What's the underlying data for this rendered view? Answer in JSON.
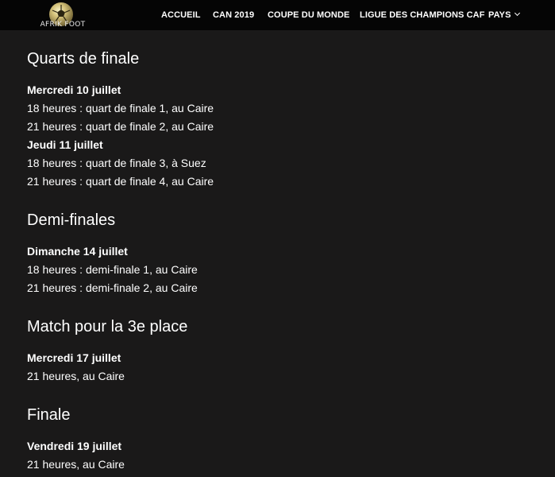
{
  "header": {
    "logo_text": "AFRIK FOOT",
    "nav": [
      {
        "label": "ACCUEIL"
      },
      {
        "label": "CAN 2019"
      },
      {
        "label": "COUPE DU MONDE"
      },
      {
        "label": "LIGUE DES CHAMPIONS CAF"
      },
      {
        "label": "PAYS"
      }
    ]
  },
  "sections": {
    "quarts": {
      "title": "Quarts de finale",
      "day1": "Mercredi 10 juillet",
      "day1_lines": [
        "18 heures : quart de finale 1, au Caire",
        "21 heures : quart de finale 2, au Caire"
      ],
      "day2": "Jeudi 11 juillet",
      "day2_lines": [
        "18 heures : quart de finale 3, à Suez",
        "21 heures : quart de finale 4, au Caire"
      ]
    },
    "demi": {
      "title": "Demi-finales",
      "day1": "Dimanche 14 juillet",
      "day1_lines": [
        "18 heures : demi-finale 1, au Caire",
        "21 heures : demi-finale 2, au Caire"
      ]
    },
    "troisieme": {
      "title": "Match pour la 3e place",
      "day1": "Mercredi 17 juillet",
      "day1_lines": [
        "21 heures, au Caire"
      ]
    },
    "finale": {
      "title": "Finale",
      "day1": "Vendredi 19 juillet",
      "day1_lines": [
        "21 heures, au Caire"
      ]
    }
  },
  "colors": {
    "background": "#1a1919",
    "header_background": "#050505",
    "text": "#ffffff"
  }
}
